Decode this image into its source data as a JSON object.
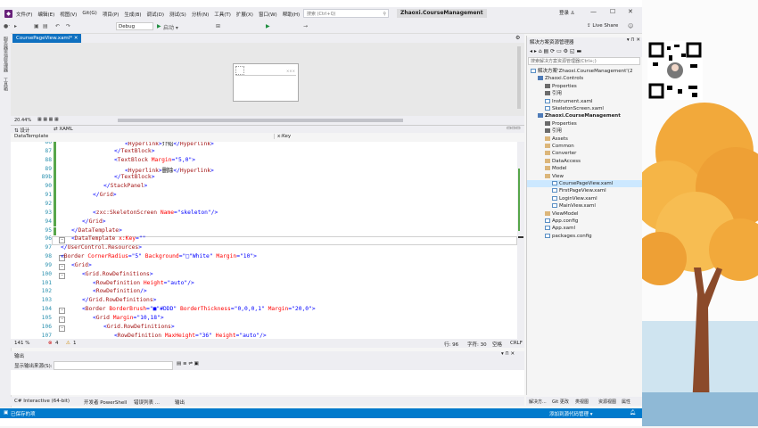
{
  "titlebar": {
    "menus": [
      "文件(F)",
      "编辑(E)",
      "视图(V)",
      "Git(G)",
      "项目(P)",
      "生成(B)",
      "调试(D)",
      "测试(S)",
      "分析(N)",
      "工具(T)",
      "扩展(X)",
      "窗口(W)",
      "帮助(H)"
    ],
    "search_placeholder": "搜索 (Ctrl+Q)",
    "solution_name": "Zhaoxi.CourseManagement",
    "login": "登录",
    "live_share": "Live Share"
  },
  "toolbar": {
    "config": "Debug",
    "start": "启动 ▾"
  },
  "document": {
    "tab": "CoursePageView.xaml*",
    "zoom": "20.44%",
    "split_design": "设计",
    "split_xaml": "XAML",
    "nav_left": "DataTemplate",
    "nav_right": "x:Key",
    "artboard_text": "×××"
  },
  "code": [
    {
      "n": "86",
      "i": 9,
      "parts": [
        [
          "t-br",
          "<"
        ],
        [
          "t-tag",
          "Hyperlink"
        ],
        [
          "t-br",
          ">"
        ],
        [
          "t-txt",
          "介绍"
        ],
        [
          "t-br",
          "</"
        ],
        [
          "t-tag",
          "Hyperlink"
        ],
        [
          "t-br",
          ">"
        ]
      ]
    },
    {
      "n": "87",
      "i": 8,
      "parts": [
        [
          "t-br",
          "</"
        ],
        [
          "t-tag",
          "TextBlock"
        ],
        [
          "t-br",
          ">"
        ]
      ]
    },
    {
      "n": "88",
      "i": 8,
      "parts": [
        [
          "t-br",
          "<"
        ],
        [
          "t-tag",
          "TextBlock"
        ],
        [
          "t-attr",
          " Margin"
        ],
        [
          "t-br",
          "="
        ],
        [
          "t-val",
          "\"5,0\""
        ],
        [
          "t-br",
          ">"
        ]
      ]
    },
    {
      "n": "89",
      "i": 9,
      "parts": [
        [
          "t-br",
          "<"
        ],
        [
          "t-tag",
          "Hyperlink"
        ],
        [
          "t-br",
          ">"
        ],
        [
          "t-txt",
          "删除"
        ],
        [
          "t-br",
          "</"
        ],
        [
          "t-tag",
          "Hyperlink"
        ],
        [
          "t-br",
          ">"
        ]
      ]
    },
    {
      "n": "89b",
      "i": 8,
      "parts": [
        [
          "t-br",
          "</"
        ],
        [
          "t-tag",
          "TextBlock"
        ],
        [
          "t-br",
          ">"
        ]
      ]
    },
    {
      "n": "90",
      "i": 7,
      "parts": [
        [
          "t-br",
          "</"
        ],
        [
          "t-tag",
          "StackPanel"
        ],
        [
          "t-br",
          ">"
        ]
      ]
    },
    {
      "n": "91",
      "i": 6,
      "parts": [
        [
          "t-br",
          "</"
        ],
        [
          "t-tag",
          "Grid"
        ],
        [
          "t-br",
          ">"
        ]
      ]
    },
    {
      "n": "92",
      "i": 0,
      "parts": []
    },
    {
      "n": "93",
      "i": 6,
      "parts": [
        [
          "t-br",
          "<"
        ],
        [
          "t-tag",
          "zxc:SkeletonScreen"
        ],
        [
          "t-attr",
          " Name"
        ],
        [
          "t-br",
          "="
        ],
        [
          "t-val",
          "\"skeleton\""
        ],
        [
          "t-br",
          "/>"
        ]
      ]
    },
    {
      "n": "94",
      "i": 5,
      "parts": [
        [
          "t-br",
          "</"
        ],
        [
          "t-tag",
          "Grid"
        ],
        [
          "t-br",
          ">"
        ]
      ]
    },
    {
      "n": "95",
      "i": 4,
      "parts": [
        [
          "t-br",
          "</"
        ],
        [
          "t-tag",
          "DataTemplate"
        ],
        [
          "t-br",
          ">"
        ]
      ]
    },
    {
      "n": "96",
      "i": 4,
      "parts": [
        [
          "t-br",
          "<"
        ],
        [
          "t-tag",
          "DataTemplate"
        ],
        [
          "t-attr",
          " x:Key"
        ],
        [
          "t-br",
          "="
        ],
        [
          "t-val",
          "\"\""
        ]
      ]
    },
    {
      "n": "97",
      "i": 3,
      "parts": [
        [
          "t-br",
          "</"
        ],
        [
          "t-tag",
          "UserControl.Resources"
        ],
        [
          "t-br",
          ">"
        ]
      ]
    },
    {
      "n": "98",
      "i": 3,
      "parts": [
        [
          "t-br",
          "<"
        ],
        [
          "t-tag",
          "Border"
        ],
        [
          "t-attr",
          " CornerRadius"
        ],
        [
          "t-br",
          "="
        ],
        [
          "t-val",
          "\"5\""
        ],
        [
          "t-attr",
          " Background"
        ],
        [
          "t-br",
          "="
        ],
        [
          "t-val",
          "\"□\"White\""
        ],
        [
          "t-attr",
          " Margin"
        ],
        [
          "t-br",
          "="
        ],
        [
          "t-val",
          "\"10\""
        ],
        [
          "t-br",
          ">"
        ]
      ]
    },
    {
      "n": "99",
      "i": 4,
      "parts": [
        [
          "t-br",
          "<"
        ],
        [
          "t-tag",
          "Grid"
        ],
        [
          "t-br",
          ">"
        ]
      ]
    },
    {
      "n": "100",
      "i": 5,
      "parts": [
        [
          "t-br",
          "<"
        ],
        [
          "t-tag",
          "Grid.RowDefinitions"
        ],
        [
          "t-br",
          ">"
        ]
      ]
    },
    {
      "n": "101",
      "i": 6,
      "parts": [
        [
          "t-br",
          "<"
        ],
        [
          "t-tag",
          "RowDefinition"
        ],
        [
          "t-attr",
          " Height"
        ],
        [
          "t-br",
          "="
        ],
        [
          "t-val",
          "\"auto\""
        ],
        [
          "t-br",
          "/>"
        ]
      ]
    },
    {
      "n": "102",
      "i": 6,
      "parts": [
        [
          "t-br",
          "<"
        ],
        [
          "t-tag",
          "RowDefinition"
        ],
        [
          "t-br",
          "/>"
        ]
      ]
    },
    {
      "n": "103",
      "i": 5,
      "parts": [
        [
          "t-br",
          "</"
        ],
        [
          "t-tag",
          "Grid.RowDefinitions"
        ],
        [
          "t-br",
          ">"
        ]
      ]
    },
    {
      "n": "104",
      "i": 5,
      "parts": [
        [
          "t-br",
          "<"
        ],
        [
          "t-tag",
          "Border"
        ],
        [
          "t-attr",
          " BorderBrush"
        ],
        [
          "t-br",
          "="
        ],
        [
          "t-val",
          "\"■\"#DDD\""
        ],
        [
          "t-attr",
          " BorderThickness"
        ],
        [
          "t-br",
          "="
        ],
        [
          "t-val",
          "\"0,0,0,1\""
        ],
        [
          "t-attr",
          " Margin"
        ],
        [
          "t-br",
          "="
        ],
        [
          "t-val",
          "\"20,0\""
        ],
        [
          "t-br",
          ">"
        ]
      ]
    },
    {
      "n": "105",
      "i": 6,
      "parts": [
        [
          "t-br",
          "<"
        ],
        [
          "t-tag",
          "Grid"
        ],
        [
          "t-attr",
          " Margin"
        ],
        [
          "t-br",
          "="
        ],
        [
          "t-val",
          "\"10,18\""
        ],
        [
          "t-br",
          ">"
        ]
      ]
    },
    {
      "n": "106",
      "i": 7,
      "parts": [
        [
          "t-br",
          "<"
        ],
        [
          "t-tag",
          "Grid.RowDefinitions"
        ],
        [
          "t-br",
          ">"
        ]
      ]
    },
    {
      "n": "107",
      "i": 8,
      "parts": [
        [
          "t-br",
          "<"
        ],
        [
          "t-tag",
          "RowDefinition"
        ],
        [
          "t-attr",
          " MaxHeight"
        ],
        [
          "t-br",
          "="
        ],
        [
          "t-val",
          "\"36\""
        ],
        [
          "t-attr",
          " Height"
        ],
        [
          "t-br",
          "="
        ],
        [
          "t-val",
          "\"auto\""
        ],
        [
          "t-br",
          "/>"
        ]
      ]
    }
  ],
  "editor_status": {
    "zoom": "141 %",
    "errors": "4",
    "warnings": "1",
    "row": "行: 96",
    "col": "字符: 30",
    "mode": "空格",
    "eol": "CRLF"
  },
  "output": {
    "title": "输出",
    "source_label": "显示输出来源(S):",
    "tabs": [
      "C# Interactive (64-bit)",
      "开发者 PowerShell",
      "错误列表 ...",
      "输出"
    ]
  },
  "solution_explorer": {
    "title": "解决方案资源管理器",
    "search_placeholder": "搜索解决方案资源管理器(Ctrl+;)",
    "items": [
      {
        "label": "解决方案'Zhaoxi.CourseManagement'(2",
        "lvl": 0,
        "type": "file",
        "bold": false
      },
      {
        "label": "Zhaoxi.Controls",
        "lvl": 1,
        "type": "proj",
        "bold": false
      },
      {
        "label": "Properties",
        "lvl": 2,
        "type": "ref",
        "bold": false
      },
      {
        "label": "引用",
        "lvl": 2,
        "type": "ref",
        "bold": false
      },
      {
        "label": "Instrument.xaml",
        "lvl": 2,
        "type": "file",
        "bold": false
      },
      {
        "label": "SkeletonScreen.xaml",
        "lvl": 2,
        "type": "file",
        "bold": false
      },
      {
        "label": "Zhaoxi.CourseManagement",
        "lvl": 1,
        "type": "proj",
        "bold": true
      },
      {
        "label": "Properties",
        "lvl": 2,
        "type": "ref",
        "bold": false
      },
      {
        "label": "引用",
        "lvl": 2,
        "type": "ref",
        "bold": false
      },
      {
        "label": "Assets",
        "lvl": 2,
        "type": "folder",
        "bold": false
      },
      {
        "label": "Common",
        "lvl": 2,
        "type": "folder",
        "bold": false
      },
      {
        "label": "Converter",
        "lvl": 2,
        "type": "folder",
        "bold": false
      },
      {
        "label": "DataAccess",
        "lvl": 2,
        "type": "folder",
        "bold": false
      },
      {
        "label": "Model",
        "lvl": 2,
        "type": "folder",
        "bold": false
      },
      {
        "label": "View",
        "lvl": 2,
        "type": "folder",
        "bold": false
      },
      {
        "label": "CoursePageView.xaml",
        "lvl": 3,
        "type": "file",
        "bold": false,
        "selected": true
      },
      {
        "label": "FirstPageView.xaml",
        "lvl": 3,
        "type": "file",
        "bold": false
      },
      {
        "label": "LoginView.xaml",
        "lvl": 3,
        "type": "file",
        "bold": false
      },
      {
        "label": "MainView.xaml",
        "lvl": 3,
        "type": "file",
        "bold": false
      },
      {
        "label": "ViewModel",
        "lvl": 2,
        "type": "folder",
        "bold": false
      },
      {
        "label": "App.config",
        "lvl": 2,
        "type": "file",
        "bold": false
      },
      {
        "label": "App.xaml",
        "lvl": 2,
        "type": "file",
        "bold": false
      },
      {
        "label": "packages.config",
        "lvl": 2,
        "type": "file",
        "bold": false
      }
    ],
    "bottom_tabs": [
      "解决方...",
      "Git 更改",
      "类视图",
      "资源视图",
      "属性"
    ]
  },
  "statusbar": {
    "left": "已保存的项",
    "right": "添加到源代码管理 ▾"
  },
  "colors": {
    "accent": "#007acc",
    "selection": "#cce8ff",
    "tag": "#a31515",
    "attr": "#ff0000",
    "value": "#0000ff"
  }
}
